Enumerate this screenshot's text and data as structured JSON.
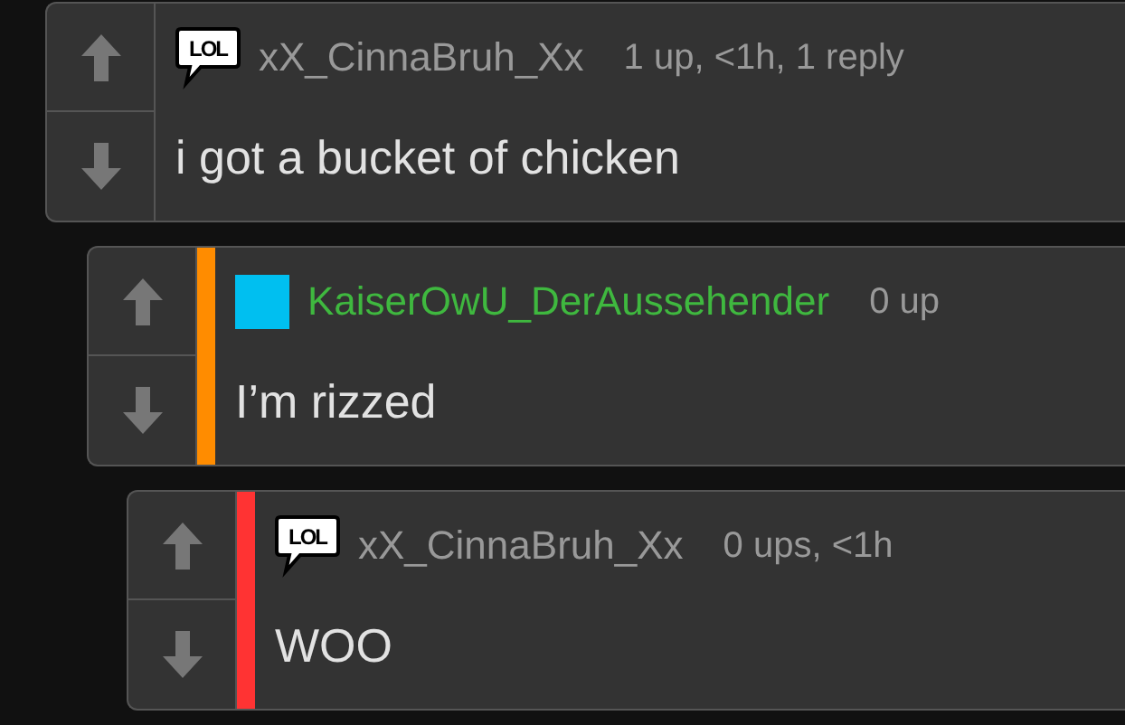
{
  "comments": [
    {
      "avatar": {
        "kind": "lol",
        "label": "LOL"
      },
      "username": {
        "text": "xX_CinnaBruh_Xx",
        "color": "#999999"
      },
      "meta": "1 up, <1h, 1 reply",
      "text": "i got a bucket of chicken"
    },
    {
      "avatar": {
        "kind": "square",
        "color": "#00bff0"
      },
      "username": {
        "text": "KaiserOwU_DerAussehender",
        "color": "#3fb83f"
      },
      "meta": "0 up",
      "text": "I’m rizzed",
      "color": "#ff8c00"
    },
    {
      "avatar": {
        "kind": "lol",
        "label": "LOL"
      },
      "username": {
        "text": "xX_CinnaBruh_Xx",
        "color": "#999999"
      },
      "meta": "0 ups, <1h",
      "text": "WOO",
      "color": "#ff3333"
    }
  ]
}
